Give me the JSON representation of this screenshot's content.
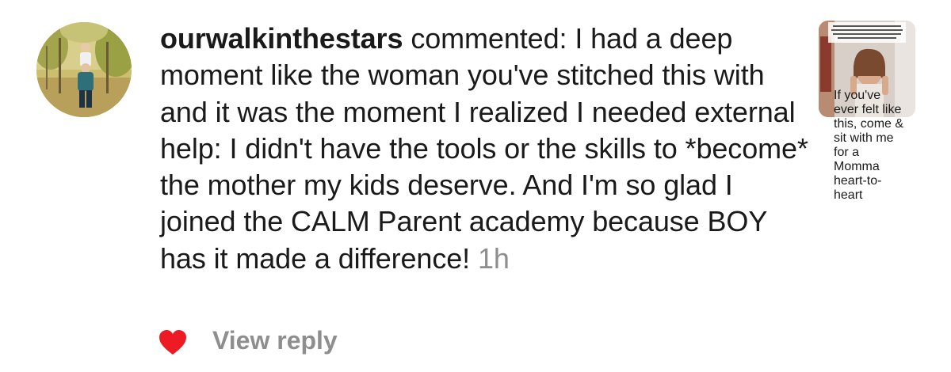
{
  "comment": {
    "username": "ourwalkinthestars",
    "action": "commented:",
    "text": "I had a deep moment like the woman you've stitched this with and it was the moment I realized I needed external help: I didn't have the tools or the skills to *become* the mother my kids deserve. And I'm so glad I joined the CALM Parent academy because BOY has it made a difference!",
    "timestamp": "1h"
  },
  "thumbnail": {
    "caption": "If you've ever felt like this, come & sit with me for a Momma heart-to-heart"
  },
  "actions": {
    "like_icon": "heart-icon",
    "like_color": "#ed1c24",
    "view_reply_label": "View reply"
  },
  "colors": {
    "text": "#1a1a1a",
    "muted": "#8e8e8e"
  }
}
